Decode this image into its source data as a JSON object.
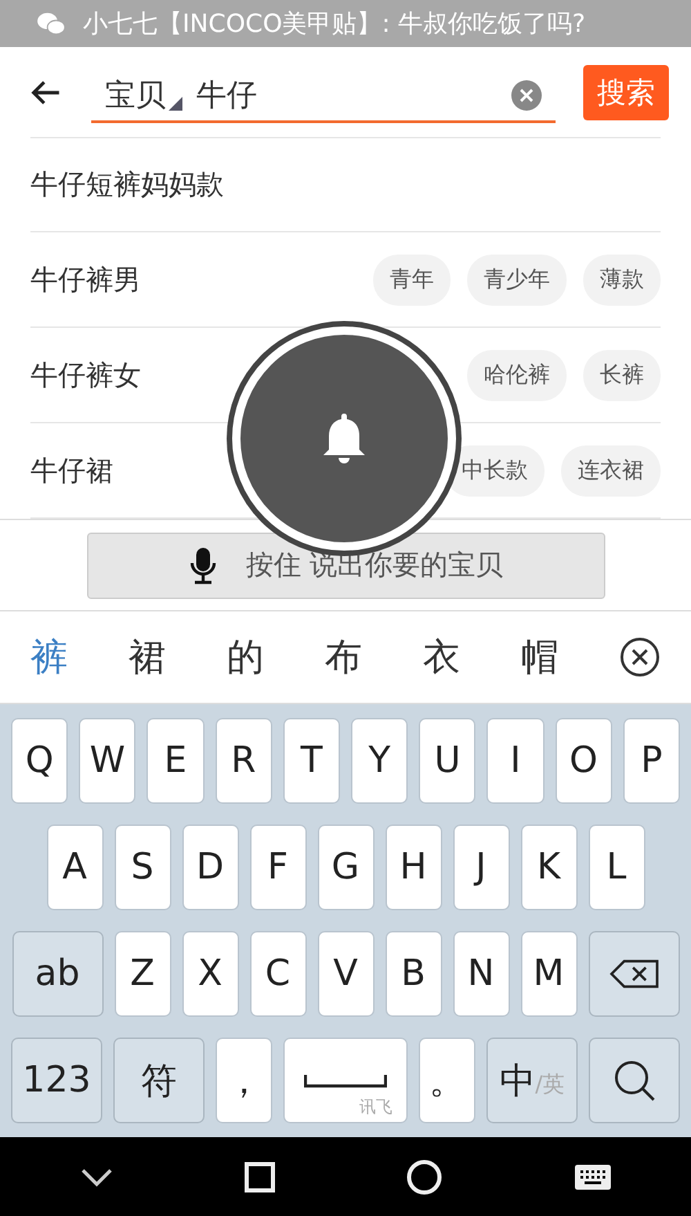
{
  "status_bar": {
    "notification": "小七七【INCOCO美甲贴】: 牛叔你吃饭了吗?"
  },
  "search": {
    "scope": "宝贝",
    "value": "牛仔",
    "button": "搜索"
  },
  "suggestions": [
    {
      "text": "牛仔短裤妈妈款"
    },
    {
      "text": "牛仔裤男",
      "tags": [
        "青年",
        "青少年",
        "薄款"
      ]
    },
    {
      "text": "牛仔裤女",
      "tags": [
        "哈伦裤",
        "长裤"
      ]
    },
    {
      "text": "牛仔裙",
      "tags": [
        "中长款",
        "连衣裙"
      ]
    }
  ],
  "voice_button": {
    "label": "按住 说出你要的宝贝"
  },
  "candidates": [
    {
      "text": "裤",
      "selected": true
    },
    {
      "text": "裙",
      "selected": false
    },
    {
      "text": "的",
      "selected": false
    },
    {
      "text": "布",
      "selected": false
    },
    {
      "text": "衣",
      "selected": false
    },
    {
      "text": "帽",
      "selected": false
    }
  ],
  "keyboard": [
    [
      {
        "kind": "char",
        "label": "Q"
      },
      {
        "kind": "char",
        "label": "W"
      },
      {
        "kind": "char",
        "label": "E"
      },
      {
        "kind": "char",
        "label": "R"
      },
      {
        "kind": "char",
        "label": "T"
      },
      {
        "kind": "char",
        "label": "Y"
      },
      {
        "kind": "char",
        "label": "U"
      },
      {
        "kind": "char",
        "label": "I"
      },
      {
        "kind": "char",
        "label": "O"
      },
      {
        "kind": "char",
        "label": "P"
      }
    ],
    [
      {
        "kind": "char",
        "label": "A"
      },
      {
        "kind": "char",
        "label": "S"
      },
      {
        "kind": "char",
        "label": "D"
      },
      {
        "kind": "char",
        "label": "F"
      },
      {
        "kind": "char",
        "label": "G"
      },
      {
        "kind": "char",
        "label": "H"
      },
      {
        "kind": "char",
        "label": "J"
      },
      {
        "kind": "char",
        "label": "K"
      },
      {
        "kind": "char",
        "label": "L"
      }
    ],
    [
      {
        "kind": "fn",
        "label": "ab"
      },
      {
        "kind": "char",
        "label": "Z"
      },
      {
        "kind": "char",
        "label": "X"
      },
      {
        "kind": "char",
        "label": "C"
      },
      {
        "kind": "char",
        "label": "V"
      },
      {
        "kind": "char",
        "label": "B"
      },
      {
        "kind": "char",
        "label": "N"
      },
      {
        "kind": "char",
        "label": "M"
      },
      {
        "kind": "backspace"
      }
    ],
    [
      {
        "kind": "fn",
        "label": "123"
      },
      {
        "kind": "fn",
        "label": "符"
      },
      {
        "kind": "char",
        "label": "，"
      },
      {
        "kind": "space",
        "sub": "讯飞"
      },
      {
        "kind": "char",
        "label": "。"
      },
      {
        "kind": "fn",
        "label": "中",
        "sub": "/英"
      },
      {
        "kind": "search"
      }
    ]
  ]
}
